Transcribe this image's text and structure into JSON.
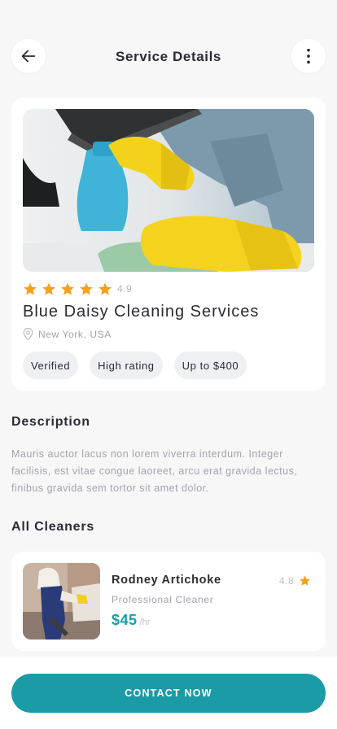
{
  "header": {
    "title": "Service Details",
    "back_icon": "arrow-left-icon",
    "more_icon": "more-vertical-icon"
  },
  "service": {
    "rating": 4.9,
    "rating_text": "4.9",
    "stars_filled": 5,
    "name": "Blue Daisy Cleaning Services",
    "location": "New York, USA",
    "tags": [
      "Verified",
      "High rating",
      "Up to $400"
    ]
  },
  "description": {
    "title": "Description",
    "text": "Mauris auctor lacus non lorem viverra interdum. Integer facilisis, est vitae congue laoreet, arcu erat gravida lectus, finibus gravida sem tortor sit amet dolor."
  },
  "cleaners": {
    "title": "All Cleaners",
    "items": [
      {
        "name": "Rodney Artichoke",
        "role": "Professional Cleaner",
        "price": "$45",
        "unit": "/hr",
        "rating": "4.8"
      }
    ]
  },
  "contact_button": "CONTACT NOW",
  "colors": {
    "accent": "#1b9ba6",
    "price": "#14a0ad",
    "star": "#f4a21d",
    "background": "#f7f7f8"
  }
}
